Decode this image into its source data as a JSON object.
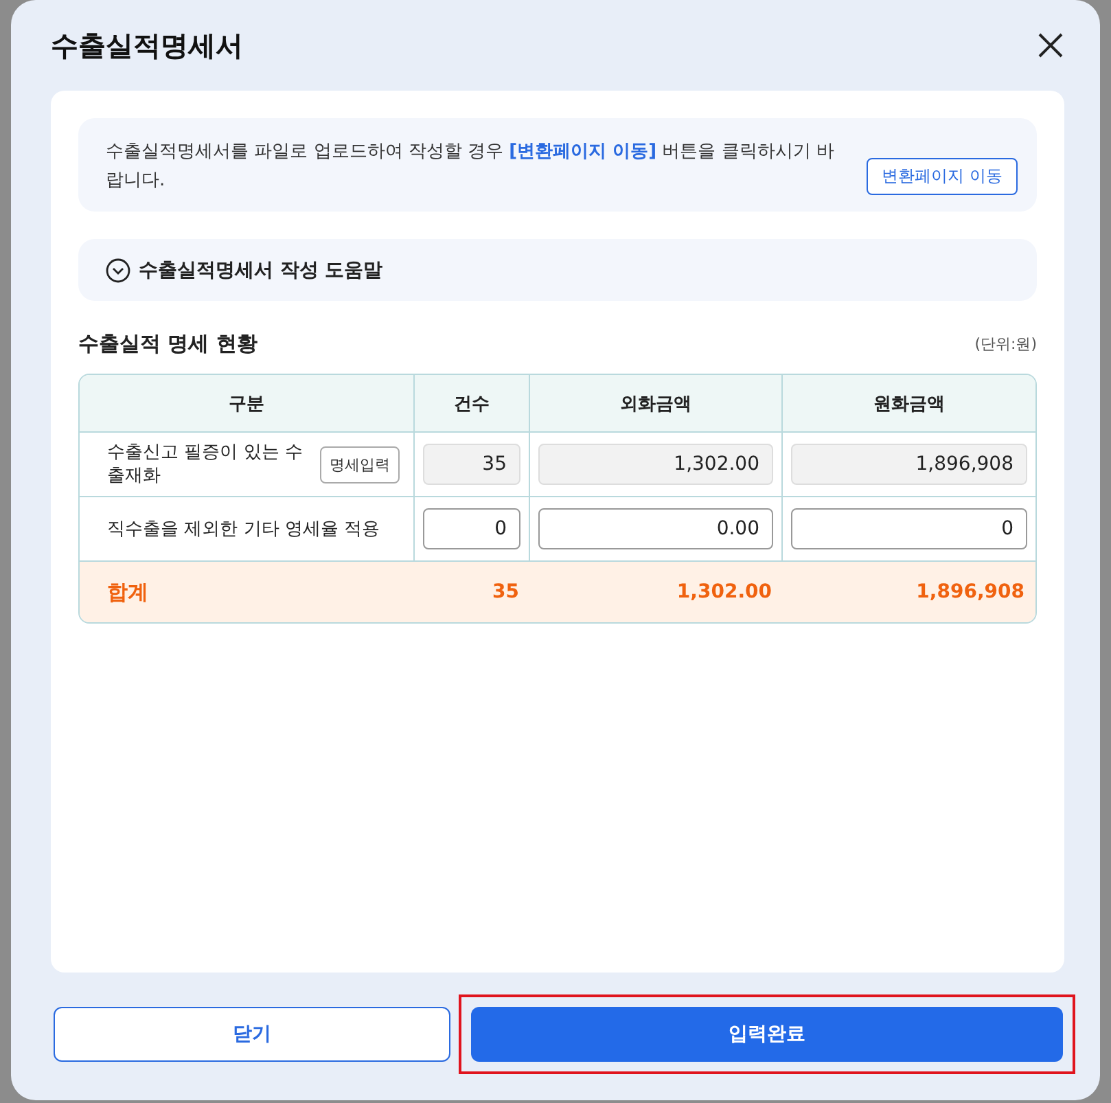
{
  "dialog": {
    "title": "수출실적명세서"
  },
  "notice": {
    "text": "수출실적명세서를 파일로 업로드하여 작성할 경우 **[변환페이지 이동]** 버튼을 클릭하시기 바랍니다.",
    "button": "변환페이지 이동"
  },
  "help": {
    "label": "수출실적명세서 작성 도움말",
    "expanded": false
  },
  "section": {
    "title": "수출실적 명세 현황",
    "unit": "(단위:원)"
  },
  "table": {
    "columns": [
      "구분",
      "건수",
      "외화금액",
      "원화금액"
    ],
    "rows": [
      {
        "label": "수출신고 필증이 있는 수출재화",
        "button": "명세입력",
        "fields": [
          {
            "value": "35",
            "readonly": true
          },
          {
            "value": "1,302.00",
            "readonly": true
          },
          {
            "value": "1,896,908",
            "readonly": true
          }
        ]
      },
      {
        "label": "직수출을 제외한 기타 영세율 적용",
        "fields": [
          {
            "value": "0",
            "readonly": false
          },
          {
            "value": "0.00",
            "readonly": false
          },
          {
            "value": "0",
            "readonly": false
          }
        ]
      }
    ],
    "total": {
      "label": "합계",
      "values": [
        "35",
        "1,302.00",
        "1,896,908"
      ]
    }
  },
  "buttons": [
    {
      "label": "닫기",
      "kind": "secondary",
      "highlighted": false
    },
    {
      "label": "입력완료",
      "kind": "primary",
      "highlighted": true
    }
  ]
}
